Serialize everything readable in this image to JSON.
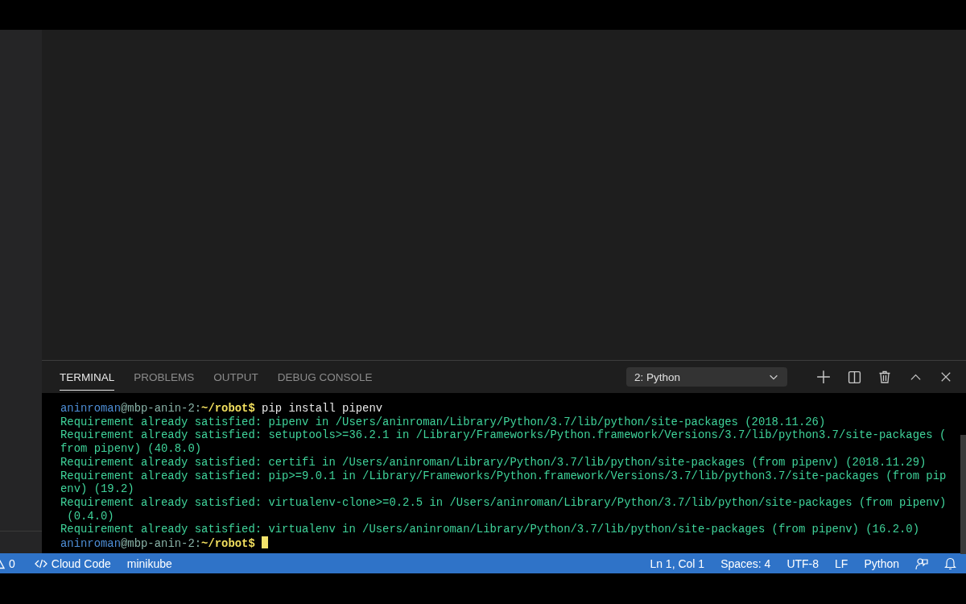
{
  "panel": {
    "tabs": [
      {
        "label": "TERMINAL",
        "selected": true
      },
      {
        "label": "PROBLEMS",
        "selected": false
      },
      {
        "label": "OUTPUT",
        "selected": false
      },
      {
        "label": "DEBUG CONSOLE",
        "selected": false
      }
    ],
    "terminal_select": {
      "value": "2: Python"
    }
  },
  "terminal": {
    "lines": [
      {
        "kind": "prompt",
        "user": "aninroman",
        "host": "@mbp-anin-2:",
        "path": "~/robot$",
        "command": " pip install pipenv"
      },
      {
        "kind": "output",
        "text": "Requirement already satisfied: pipenv in /Users/aninroman/Library/Python/3.7/lib/python/site-packages (2018.11.26)"
      },
      {
        "kind": "output",
        "text": "Requirement already satisfied: setuptools>=36.2.1 in /Library/Frameworks/Python.framework/Versions/3.7/lib/python3.7/site-packages ("
      },
      {
        "kind": "output",
        "text": "from pipenv) (40.8.0)"
      },
      {
        "kind": "output",
        "text": "Requirement already satisfied: certifi in /Users/aninroman/Library/Python/3.7/lib/python/site-packages (from pipenv) (2018.11.29)"
      },
      {
        "kind": "output",
        "text": "Requirement already satisfied: pip>=9.0.1 in /Library/Frameworks/Python.framework/Versions/3.7/lib/python3.7/site-packages (from pip"
      },
      {
        "kind": "output",
        "text": "env) (19.2)"
      },
      {
        "kind": "output",
        "text": "Requirement already satisfied: virtualenv-clone>=0.2.5 in /Users/aninroman/Library/Python/3.7/lib/python/site-packages (from pipenv)"
      },
      {
        "kind": "output",
        "text": " (0.4.0)"
      },
      {
        "kind": "output",
        "text": "Requirement already satisfied: virtualenv in /Users/aninroman/Library/Python/3.7/lib/python/site-packages (from pipenv) (16.2.0)"
      },
      {
        "kind": "prompt",
        "user": "aninroman",
        "host": "@mbp-anin-2:",
        "path": "~/robot$",
        "cursor": true
      }
    ]
  },
  "status_bar": {
    "left": [
      {
        "kind": "warnings",
        "text": "0"
      },
      {
        "kind": "code",
        "text": "Cloud Code"
      },
      {
        "kind": "plain",
        "text": "minikube"
      }
    ],
    "right": [
      "Ln 1, Col 1",
      "Spaces: 4",
      "UTF-8",
      "LF",
      "Python"
    ]
  }
}
